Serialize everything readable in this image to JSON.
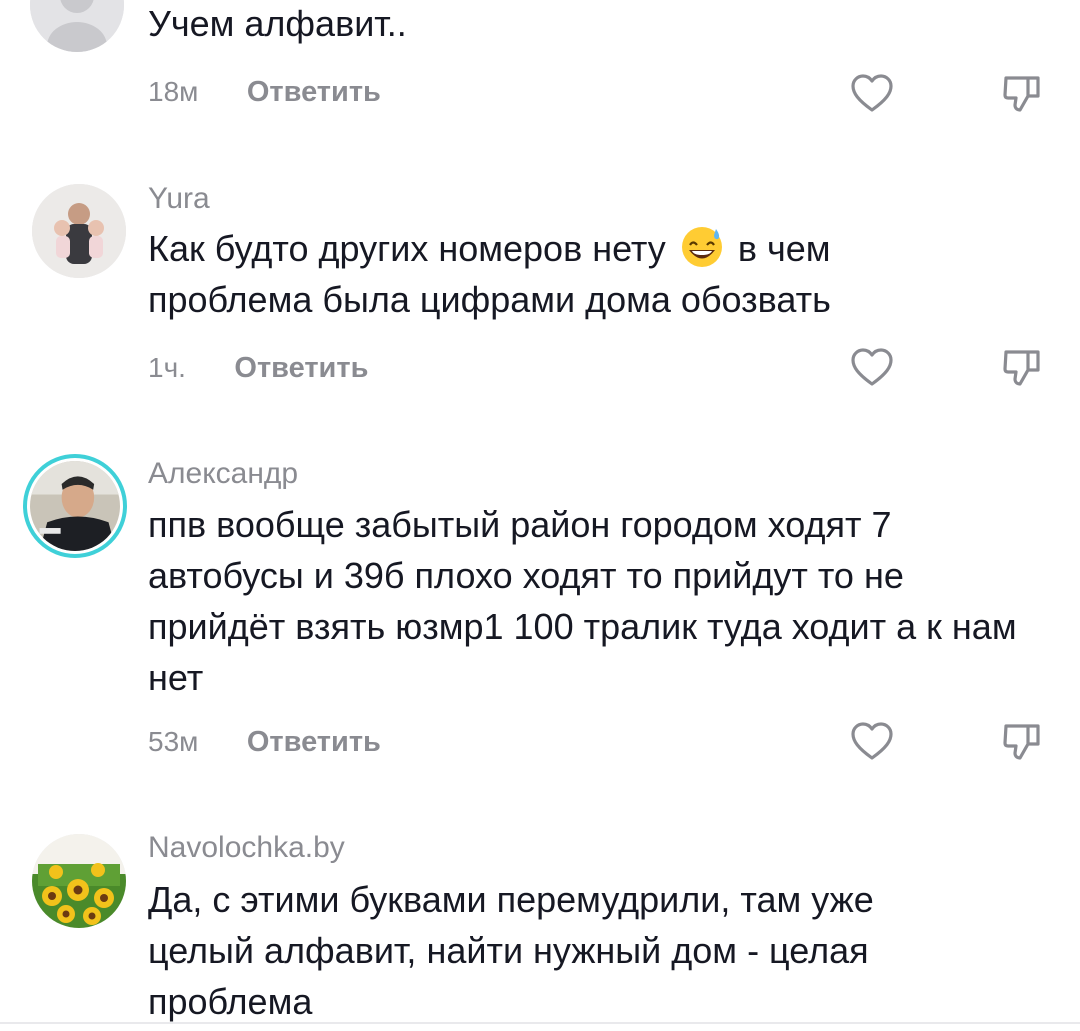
{
  "comments": [
    {
      "username": "",
      "text": "Учем алфавит..",
      "time": "18м",
      "reply_label": "Ответить",
      "avatar": "default-avatar"
    },
    {
      "username": "Yura",
      "text_before_emoji": "Как будто других номеров нету",
      "emoji": "grinning-sweat-emoji",
      "text_after_emoji": "в чем проблема была цифрами дома обозвать",
      "time": "1ч.",
      "reply_label": "Ответить",
      "avatar": "user-photo"
    },
    {
      "username": "Александр",
      "text": "ппв вообще забытый район городом ходят 7 автобусы и 39б плохо ходят то прийдут то не прийдёт взять юзмр1 100 тралик туда ходит а к нам нет",
      "time": "53м",
      "reply_label": "Ответить",
      "avatar": "user-photo-with-story-ring"
    },
    {
      "username": "Navolochka.by",
      "text": "Да, с этими буквами перемудрили, там уже целый алфавит, найти нужный дом - целая проблема",
      "avatar": "sunflower-bedding-photo"
    }
  ],
  "icons": {
    "like": "heart-outline-icon",
    "dislike": "thumbs-down-icon"
  },
  "colors": {
    "text": "#161823",
    "secondary": "#8a8b91",
    "story_ring": "#3fd0d8"
  }
}
